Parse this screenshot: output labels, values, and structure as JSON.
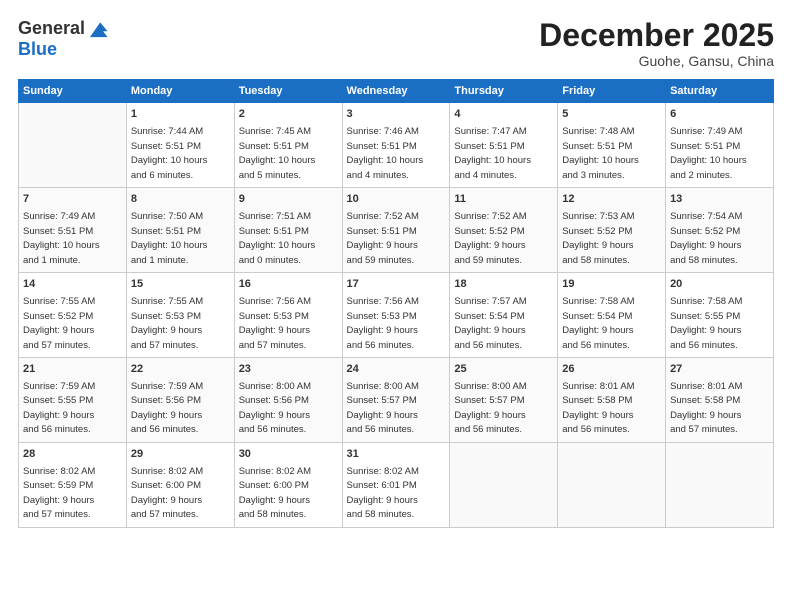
{
  "header": {
    "logo_line1": "General",
    "logo_line2": "Blue",
    "month": "December 2025",
    "location": "Guohe, Gansu, China"
  },
  "weekdays": [
    "Sunday",
    "Monday",
    "Tuesday",
    "Wednesday",
    "Thursday",
    "Friday",
    "Saturday"
  ],
  "weeks": [
    [
      {
        "day": "",
        "info": ""
      },
      {
        "day": "1",
        "info": "Sunrise: 7:44 AM\nSunset: 5:51 PM\nDaylight: 10 hours\nand 6 minutes."
      },
      {
        "day": "2",
        "info": "Sunrise: 7:45 AM\nSunset: 5:51 PM\nDaylight: 10 hours\nand 5 minutes."
      },
      {
        "day": "3",
        "info": "Sunrise: 7:46 AM\nSunset: 5:51 PM\nDaylight: 10 hours\nand 4 minutes."
      },
      {
        "day": "4",
        "info": "Sunrise: 7:47 AM\nSunset: 5:51 PM\nDaylight: 10 hours\nand 4 minutes."
      },
      {
        "day": "5",
        "info": "Sunrise: 7:48 AM\nSunset: 5:51 PM\nDaylight: 10 hours\nand 3 minutes."
      },
      {
        "day": "6",
        "info": "Sunrise: 7:49 AM\nSunset: 5:51 PM\nDaylight: 10 hours\nand 2 minutes."
      }
    ],
    [
      {
        "day": "7",
        "info": "Sunrise: 7:49 AM\nSunset: 5:51 PM\nDaylight: 10 hours\nand 1 minute."
      },
      {
        "day": "8",
        "info": "Sunrise: 7:50 AM\nSunset: 5:51 PM\nDaylight: 10 hours\nand 1 minute."
      },
      {
        "day": "9",
        "info": "Sunrise: 7:51 AM\nSunset: 5:51 PM\nDaylight: 10 hours\nand 0 minutes."
      },
      {
        "day": "10",
        "info": "Sunrise: 7:52 AM\nSunset: 5:51 PM\nDaylight: 9 hours\nand 59 minutes."
      },
      {
        "day": "11",
        "info": "Sunrise: 7:52 AM\nSunset: 5:52 PM\nDaylight: 9 hours\nand 59 minutes."
      },
      {
        "day": "12",
        "info": "Sunrise: 7:53 AM\nSunset: 5:52 PM\nDaylight: 9 hours\nand 58 minutes."
      },
      {
        "day": "13",
        "info": "Sunrise: 7:54 AM\nSunset: 5:52 PM\nDaylight: 9 hours\nand 58 minutes."
      }
    ],
    [
      {
        "day": "14",
        "info": "Sunrise: 7:55 AM\nSunset: 5:52 PM\nDaylight: 9 hours\nand 57 minutes."
      },
      {
        "day": "15",
        "info": "Sunrise: 7:55 AM\nSunset: 5:53 PM\nDaylight: 9 hours\nand 57 minutes."
      },
      {
        "day": "16",
        "info": "Sunrise: 7:56 AM\nSunset: 5:53 PM\nDaylight: 9 hours\nand 57 minutes."
      },
      {
        "day": "17",
        "info": "Sunrise: 7:56 AM\nSunset: 5:53 PM\nDaylight: 9 hours\nand 56 minutes."
      },
      {
        "day": "18",
        "info": "Sunrise: 7:57 AM\nSunset: 5:54 PM\nDaylight: 9 hours\nand 56 minutes."
      },
      {
        "day": "19",
        "info": "Sunrise: 7:58 AM\nSunset: 5:54 PM\nDaylight: 9 hours\nand 56 minutes."
      },
      {
        "day": "20",
        "info": "Sunrise: 7:58 AM\nSunset: 5:55 PM\nDaylight: 9 hours\nand 56 minutes."
      }
    ],
    [
      {
        "day": "21",
        "info": "Sunrise: 7:59 AM\nSunset: 5:55 PM\nDaylight: 9 hours\nand 56 minutes."
      },
      {
        "day": "22",
        "info": "Sunrise: 7:59 AM\nSunset: 5:56 PM\nDaylight: 9 hours\nand 56 minutes."
      },
      {
        "day": "23",
        "info": "Sunrise: 8:00 AM\nSunset: 5:56 PM\nDaylight: 9 hours\nand 56 minutes."
      },
      {
        "day": "24",
        "info": "Sunrise: 8:00 AM\nSunset: 5:57 PM\nDaylight: 9 hours\nand 56 minutes."
      },
      {
        "day": "25",
        "info": "Sunrise: 8:00 AM\nSunset: 5:57 PM\nDaylight: 9 hours\nand 56 minutes."
      },
      {
        "day": "26",
        "info": "Sunrise: 8:01 AM\nSunset: 5:58 PM\nDaylight: 9 hours\nand 56 minutes."
      },
      {
        "day": "27",
        "info": "Sunrise: 8:01 AM\nSunset: 5:58 PM\nDaylight: 9 hours\nand 57 minutes."
      }
    ],
    [
      {
        "day": "28",
        "info": "Sunrise: 8:02 AM\nSunset: 5:59 PM\nDaylight: 9 hours\nand 57 minutes."
      },
      {
        "day": "29",
        "info": "Sunrise: 8:02 AM\nSunset: 6:00 PM\nDaylight: 9 hours\nand 57 minutes."
      },
      {
        "day": "30",
        "info": "Sunrise: 8:02 AM\nSunset: 6:00 PM\nDaylight: 9 hours\nand 58 minutes."
      },
      {
        "day": "31",
        "info": "Sunrise: 8:02 AM\nSunset: 6:01 PM\nDaylight: 9 hours\nand 58 minutes."
      },
      {
        "day": "",
        "info": ""
      },
      {
        "day": "",
        "info": ""
      },
      {
        "day": "",
        "info": ""
      }
    ]
  ]
}
